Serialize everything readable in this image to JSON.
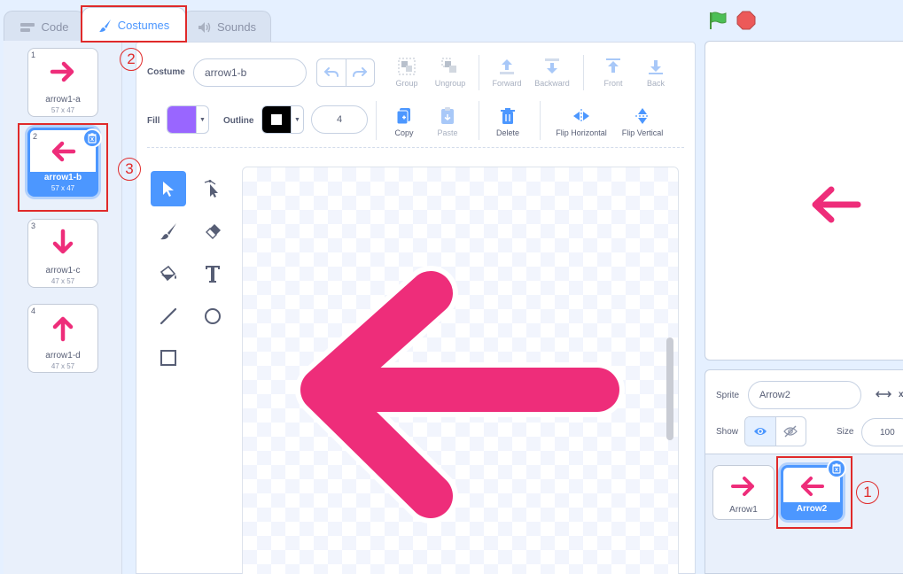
{
  "colors": {
    "accent": "#4c97ff",
    "arrow": "#ee2d7a",
    "fill": "#9966ff",
    "outline": "#000000",
    "annotation": "#e02a2a"
  },
  "tabs": [
    {
      "label": "Code",
      "icon": "code-icon"
    },
    {
      "label": "Costumes",
      "icon": "brush-icon"
    },
    {
      "label": "Sounds",
      "icon": "speaker-icon"
    }
  ],
  "costumes": [
    {
      "number": "1",
      "name": "arrow1-a",
      "size": "57 x 47",
      "direction": "right"
    },
    {
      "number": "2",
      "name": "arrow1-b",
      "size": "57 x 47",
      "direction": "left",
      "selected": true
    },
    {
      "number": "3",
      "name": "arrow1-c",
      "size": "47 x 57",
      "direction": "down"
    },
    {
      "number": "4",
      "name": "arrow1-d",
      "size": "47 x 57",
      "direction": "up"
    }
  ],
  "editor": {
    "costume_label": "Costume",
    "costume_name": "arrow1-b",
    "fill_label": "Fill",
    "outline_label": "Outline",
    "stroke_width": "4",
    "buttons": {
      "group": "Group",
      "ungroup": "Ungroup",
      "forward": "Forward",
      "backward": "Backward",
      "front": "Front",
      "back": "Back",
      "copy": "Copy",
      "paste": "Paste",
      "delete": "Delete",
      "flip_h": "Flip Horizontal",
      "flip_v": "Flip Vertical"
    },
    "tools": [
      "select-tool",
      "reshape-tool",
      "brush-tool",
      "eraser-tool",
      "fill-tool",
      "text-tool",
      "line-tool",
      "circle-tool",
      "rectangle-tool"
    ],
    "active_tool": "select-tool"
  },
  "sprite_info": {
    "sprite_label": "Sprite",
    "sprite_name": "Arrow2",
    "x_label": "x",
    "show_label": "Show",
    "size_label": "Size",
    "size_value": "100"
  },
  "sprites": [
    {
      "name": "Arrow1",
      "direction": "right"
    },
    {
      "name": "Arrow2",
      "direction": "left",
      "selected": true
    }
  ],
  "annotations": [
    "1",
    "2",
    "3"
  ]
}
